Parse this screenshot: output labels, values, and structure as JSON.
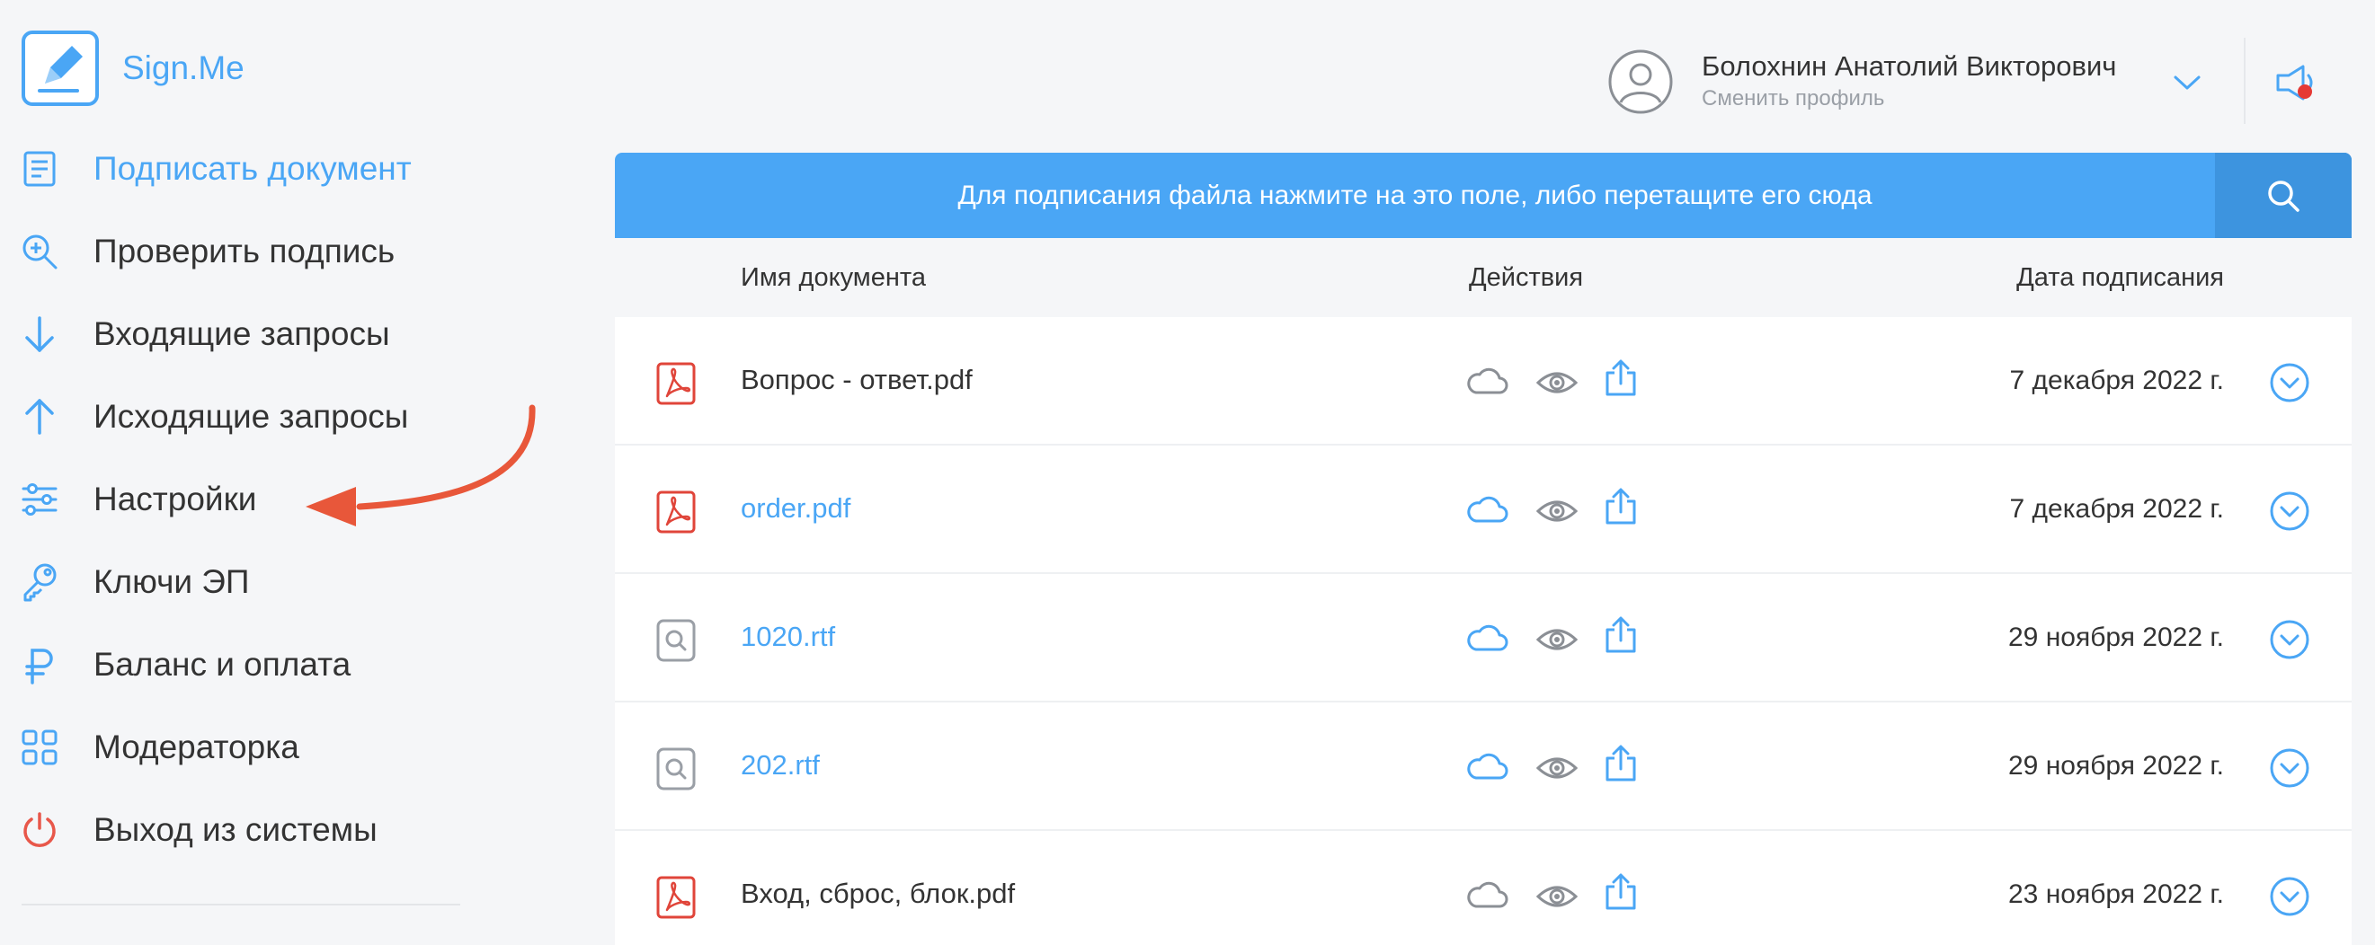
{
  "app": {
    "name": "Sign.Me"
  },
  "sidebar": {
    "items": [
      {
        "label": "Подписать документ",
        "icon": "document-icon",
        "active": true
      },
      {
        "label": "Проверить подпись",
        "icon": "zoom-check-icon"
      },
      {
        "label": "Входящие запросы",
        "icon": "arrow-down-icon"
      },
      {
        "label": "Исходящие запросы",
        "icon": "arrow-up-icon"
      },
      {
        "label": "Настройки",
        "icon": "sliders-icon"
      },
      {
        "label": "Ключи ЭП",
        "icon": "key-icon"
      },
      {
        "label": "Баланс и оплата",
        "icon": "ruble-icon"
      },
      {
        "label": "Модераторка",
        "icon": "grid-icon"
      },
      {
        "label": "Выход из системы",
        "icon": "power-icon"
      }
    ]
  },
  "user": {
    "name": "Болохнин Анатолий Викторович",
    "switch_label": "Сменить профиль"
  },
  "dropzone": {
    "text": "Для подписания файла нажмите на это поле, либо перетащите его сюда"
  },
  "table": {
    "columns": [
      "Имя документа",
      "Действия",
      "Дата подписания"
    ],
    "rows": [
      {
        "type": "pdf",
        "name": "Вопрос - ответ.pdf",
        "link": false,
        "cloud_active": false,
        "date": "7 декабря 2022 г."
      },
      {
        "type": "pdf",
        "name": "order.pdf",
        "link": true,
        "cloud_active": true,
        "date": "7 декабря 2022 г."
      },
      {
        "type": "generic",
        "name": "1020.rtf",
        "link": true,
        "cloud_active": true,
        "date": "29 ноября 2022 г."
      },
      {
        "type": "generic",
        "name": "202.rtf",
        "link": true,
        "cloud_active": true,
        "date": "29 ноября 2022 г."
      },
      {
        "type": "pdf",
        "name": "Вход, сброс, блок.pdf",
        "link": false,
        "cloud_active": false,
        "date": "23 ноября 2022 г."
      }
    ]
  },
  "colors": {
    "accent": "#4aa6f5",
    "accent_dark": "#3d94df",
    "pdf_red": "#e0453a",
    "annotation_arrow": "#e8573a",
    "notification_dot": "#e53935"
  }
}
